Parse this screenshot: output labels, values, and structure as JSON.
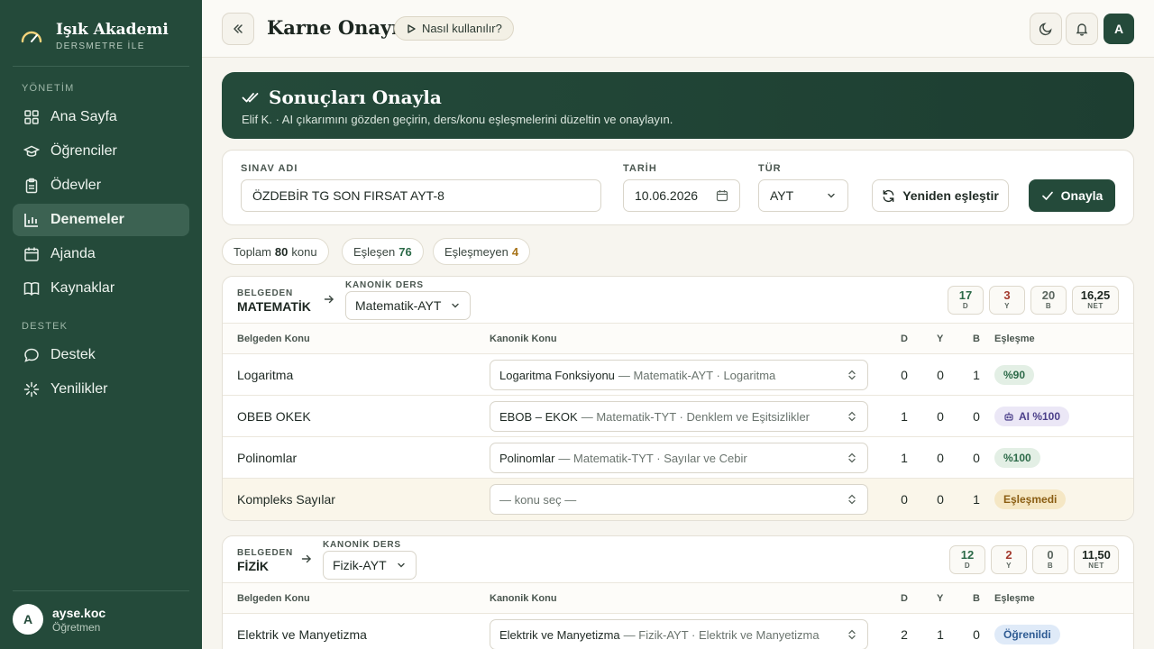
{
  "brand": {
    "name": "Işık Akademi",
    "subtitle": "DERSMETRE İLE"
  },
  "sidebar": {
    "section_management": "YÖNETİM",
    "section_support": "DESTEK",
    "items": [
      {
        "label": "Ana Sayfa",
        "icon": "grid-icon"
      },
      {
        "label": "Öğrenciler",
        "icon": "graduation-cap-icon"
      },
      {
        "label": "Ödevler",
        "icon": "clipboard-icon"
      },
      {
        "label": "Denemeler",
        "icon": "bar-chart-icon",
        "active": true
      },
      {
        "label": "Ajanda",
        "icon": "calendar-icon"
      },
      {
        "label": "Kaynaklar",
        "icon": "book-icon"
      }
    ],
    "support_items": [
      {
        "label": "Destek",
        "icon": "chat-icon"
      },
      {
        "label": "Yenilikler",
        "icon": "sparkle-icon"
      }
    ],
    "user": {
      "initial": "A",
      "name": "ayse.koc",
      "role": "Öğretmen"
    }
  },
  "topbar": {
    "title": "Karne Onayı",
    "help_label": "Nasıl kullanılır?",
    "avatar_initial": "A"
  },
  "banner": {
    "title": "Sonuçları Onayla",
    "subtitle": "Elif K. · AI çıkarımını gözden geçirin, ders/konu eşleşmelerini düzeltin ve onaylayın."
  },
  "form": {
    "exam_name_label": "SINAV ADI",
    "exam_name_value": "ÖZDEBİR TG SON FIRSAT AYT-8",
    "date_label": "TARİH",
    "date_value": "10.06.2026",
    "type_label": "TÜR",
    "type_value": "AYT",
    "rematch_label": "Yeniden eşleştir",
    "approve_label": "Onayla"
  },
  "stats": {
    "total_label": "Toplam",
    "total_value": "80",
    "total_unit": "konu",
    "matched_label": "Eşleşen",
    "matched_value": "76",
    "unmatched_label": "Eşleşmeyen",
    "unmatched_value": "4"
  },
  "table_headers": {
    "doc_topic": "Belgeden Konu",
    "canon_topic": "Kanonik Konu",
    "d": "D",
    "y": "Y",
    "b": "B",
    "match": "Eşleşme"
  },
  "labels": {
    "doc": "BELGEDEN",
    "canon": "KANONİK DERS",
    "d": "D",
    "y": "Y",
    "b": "B",
    "net": "NET"
  },
  "subjects": [
    {
      "doc_name": "MATEMATİK",
      "canon_name": "Matematik-AYT",
      "score": {
        "d": "17",
        "y": "3",
        "b": "20",
        "net": "16,25"
      },
      "rows": [
        {
          "topic": "Logaritma",
          "canon_main": "Logaritma Fonksiyonu",
          "canon_meta": "— Matematik-AYT · Logaritma",
          "d": "0",
          "y": "0",
          "b": "1",
          "badge": "%90",
          "badge_type": "green"
        },
        {
          "topic": "OBEB OKEK",
          "canon_main": "EBOB – EKOK",
          "canon_meta": "— Matematik-TYT · Denklem ve Eşitsizlikler",
          "d": "1",
          "y": "0",
          "b": "0",
          "badge": "AI %100",
          "badge_type": "purple"
        },
        {
          "topic": "Polinomlar",
          "canon_main": "Polinomlar",
          "canon_meta": "— Matematik-TYT · Sayılar ve Cebir",
          "d": "1",
          "y": "0",
          "b": "0",
          "badge": "%100",
          "badge_type": "green"
        },
        {
          "topic": "Kompleks Sayılar",
          "canon_main": "— konu seç —",
          "canon_meta": "",
          "d": "0",
          "y": "0",
          "b": "1",
          "badge": "Eşleşmedi",
          "badge_type": "amber"
        }
      ]
    },
    {
      "doc_name": "FİZİK",
      "canon_name": "Fizik-AYT",
      "score": {
        "d": "12",
        "y": "2",
        "b": "0",
        "net": "11,50"
      },
      "rows": [
        {
          "topic": "Elektrik ve Manyetizma",
          "canon_main": "Elektrik ve Manyetizma",
          "canon_meta": "— Fizik-AYT · Elektrik ve Manyetizma",
          "d": "2",
          "y": "1",
          "b": "0",
          "badge": "Öğrenildi",
          "badge_type": "blue"
        }
      ]
    }
  ]
}
